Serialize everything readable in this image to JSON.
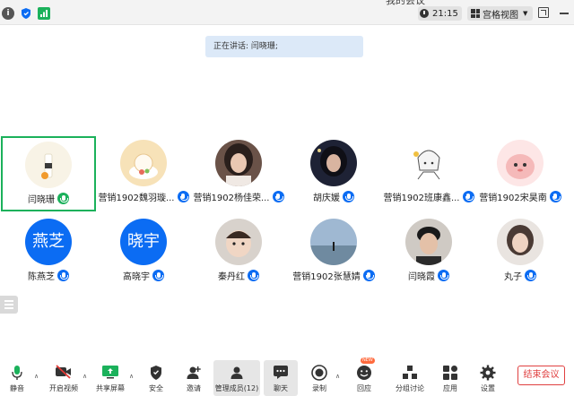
{
  "window": {
    "title_fragment": "我的会议",
    "time": "21:15",
    "view_mode": "宫格视图"
  },
  "speaker_banner": "正在讲话: 闫晓珊;",
  "participants": [
    {
      "name": "闫晓珊",
      "speaking": true
    },
    {
      "name": "营销1902魏羽璇..."
    },
    {
      "name": "营销1902杨佳荣..."
    },
    {
      "name": "胡庆媛"
    },
    {
      "name": "营销1902班康鑫..."
    },
    {
      "name": "营销1902宋昊南"
    },
    {
      "name": "陈燕芝",
      "avatar_text": "燕芝"
    },
    {
      "name": "高晓宇",
      "avatar_text": "晓宇"
    },
    {
      "name": "秦丹红"
    },
    {
      "name": "营销1902张慧婧"
    },
    {
      "name": "闫晓霞"
    },
    {
      "name": "丸子"
    }
  ],
  "toolbar": {
    "mute": "静音",
    "video": "开启视频",
    "share": "共享屏幕",
    "security": "安全",
    "invite": "邀请",
    "members": "管理成员(12)",
    "chat": "聊天",
    "record": "录制",
    "reactions": "回应",
    "new_badge": "NEW",
    "breakout": "分组讨论",
    "apps": "应用",
    "settings": "设置",
    "end": "结束会议"
  },
  "colors": {
    "accent": "#0b6cf3",
    "speaking": "#1bb15b",
    "end": "#e04040"
  }
}
